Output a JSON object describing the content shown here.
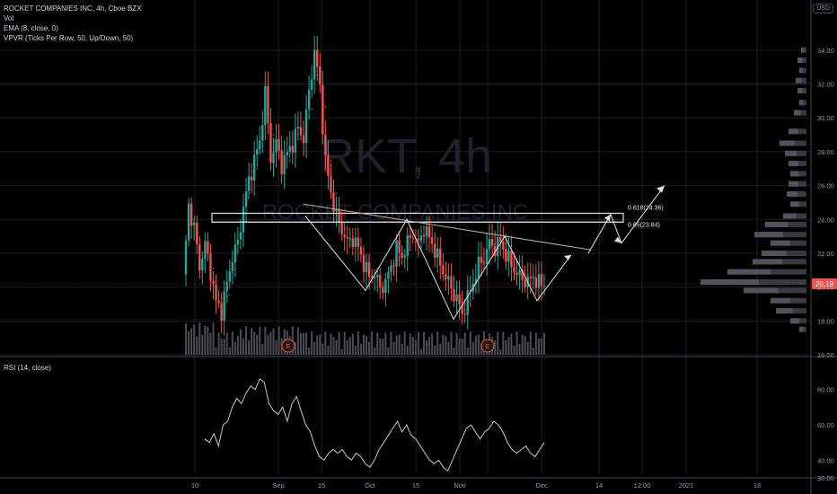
{
  "legend": {
    "symbol_line": "ROCKET COMPANIES INC, 4h, Cboe BZX",
    "vol": "Vol",
    "ema": "EMA (8, close, 0)",
    "vpvr": "VPVR (Ticks Per Row, 50, Up/Down, 50)",
    "rsi": "RSI (14, close)"
  },
  "currency_badge": "USD",
  "watermark": {
    "ticker": "RKT, 4h",
    "name": "ROCKET COMPANIES INC"
  },
  "colors": {
    "up": "#26a69a",
    "down": "#ef5350",
    "background": "#000000",
    "grid": "#1c1f26",
    "rsi_line": "#c8c8c8",
    "drawing": "#e0e0e0",
    "price_label_bg": "#ef5350"
  },
  "chart_data": [
    {
      "type": "candlestick",
      "ylim": [
        16,
        35
      ],
      "yticks": [
        "16.00",
        "18.00",
        "20.00",
        "22.00",
        "24.00",
        "26.00",
        "28.00",
        "30.00",
        "32.00",
        "34.00"
      ],
      "xticks": [
        "10",
        "Sep",
        "15",
        "Oct",
        "15",
        "Nov",
        "E",
        "Dec",
        "14",
        "12:00",
        "2021",
        "18"
      ],
      "last_price": "20.19",
      "price_path": [
        [
          0,
          20.5
        ],
        [
          2,
          24.8
        ],
        [
          4,
          23.5
        ],
        [
          6,
          21.2
        ],
        [
          8,
          22.5
        ],
        [
          10,
          20.9
        ],
        [
          12,
          19.1
        ],
        [
          14,
          18.6
        ],
        [
          16,
          20.2
        ],
        [
          18,
          21.8
        ],
        [
          20,
          22.6
        ],
        [
          22,
          24.7
        ],
        [
          24,
          26.3
        ],
        [
          26,
          27.5
        ],
        [
          28,
          28.6
        ],
        [
          30,
          31.5
        ],
        [
          32,
          27.6
        ],
        [
          34,
          28.5
        ],
        [
          36,
          27.2
        ],
        [
          38,
          27.9
        ],
        [
          40,
          28.5
        ],
        [
          42,
          29.4
        ],
        [
          44,
          28.8
        ],
        [
          46,
          31.5
        ],
        [
          48,
          33.9
        ],
        [
          50,
          31.8
        ],
        [
          52,
          27.4
        ],
        [
          54,
          25.6
        ],
        [
          56,
          24.2
        ],
        [
          58,
          23.4
        ],
        [
          60,
          22.6
        ],
        [
          62,
          22.9
        ],
        [
          64,
          22.3
        ],
        [
          66,
          21.4
        ],
        [
          68,
          20.6
        ],
        [
          70,
          20.8
        ],
        [
          72,
          19.9
        ],
        [
          74,
          20.3
        ],
        [
          76,
          21.2
        ],
        [
          78,
          22.3
        ],
        [
          80,
          21.8
        ],
        [
          82,
          22.6
        ],
        [
          84,
          23.2
        ],
        [
          86,
          22.5
        ],
        [
          88,
          23.5
        ],
        [
          90,
          22.9
        ],
        [
          92,
          22.2
        ],
        [
          94,
          21.3
        ],
        [
          96,
          20.6
        ],
        [
          98,
          19.9
        ],
        [
          100,
          19.3
        ],
        [
          102,
          18.4
        ],
        [
          104,
          19.3
        ],
        [
          106,
          20.3
        ],
        [
          108,
          21.3
        ],
        [
          110,
          21.7
        ],
        [
          112,
          22.6
        ],
        [
          114,
          22.3
        ],
        [
          116,
          22.7
        ],
        [
          118,
          21.9
        ],
        [
          120,
          21.3
        ],
        [
          122,
          20.8
        ],
        [
          124,
          20.5
        ],
        [
          126,
          20.3
        ],
        [
          128,
          20.6
        ],
        [
          130,
          20.2
        ],
        [
          131,
          20.19
        ]
      ],
      "drawings": {
        "fib_levels": [
          "0.618(24.36)",
          "0.65(23.84)"
        ],
        "has_head_and_shoulders_pattern": true,
        "earnings_markers": [
          "E",
          "E"
        ]
      }
    },
    {
      "type": "line",
      "title": "RSI (14, close)",
      "ylim": [
        30,
        90
      ],
      "yticks": [
        "80.00",
        "60.00",
        "40.00",
        "30.00"
      ],
      "values": [
        52,
        50,
        55,
        48,
        60,
        62,
        70,
        75,
        72,
        78,
        82,
        80,
        86,
        84,
        72,
        68,
        66,
        70,
        62,
        72,
        76,
        68,
        60,
        56,
        48,
        42,
        40,
        44,
        46,
        44,
        46,
        42,
        40,
        44,
        42,
        38,
        36,
        40,
        46,
        50,
        54,
        58,
        62,
        56,
        60,
        54,
        52,
        48,
        44,
        40,
        38,
        40,
        36,
        34,
        40,
        46,
        52,
        58,
        60,
        56,
        52,
        56,
        58,
        62,
        60,
        56,
        50,
        46,
        44,
        46,
        48,
        44,
        42,
        46,
        50
      ]
    }
  ]
}
